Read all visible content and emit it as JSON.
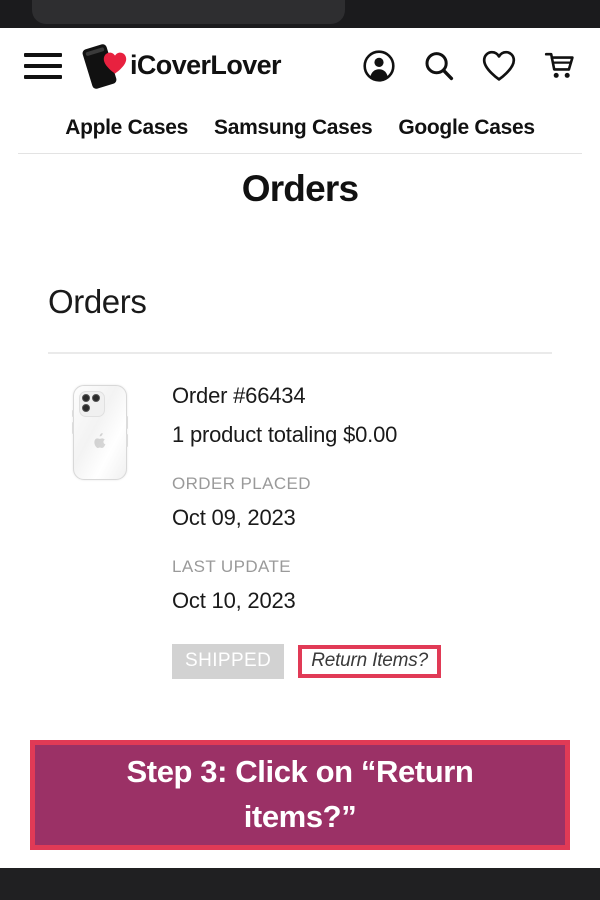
{
  "browser": {
    "top_bar": "",
    "bottom_bar": ""
  },
  "header": {
    "menu_icon": "hamburger-menu-icon",
    "logo_text": "iCoverLover",
    "logo_mark": "phone-with-heart-icon",
    "icons": [
      {
        "name": "account-icon",
        "label": "Account"
      },
      {
        "name": "search-icon",
        "label": "Search"
      },
      {
        "name": "wishlist-heart-icon",
        "label": "Wishlist"
      },
      {
        "name": "shopping-cart-icon",
        "label": "Cart"
      }
    ]
  },
  "nav": {
    "links": [
      {
        "label": "Apple Cases"
      },
      {
        "label": "Samsung Cases"
      },
      {
        "label": "Google Cases"
      }
    ]
  },
  "page": {
    "title": "Orders",
    "section_title": "Orders"
  },
  "order": {
    "thumbnail_alt": "clear-iphone-case-thumbnail",
    "number": "Order #66434",
    "summary": "1 product totaling $0.00",
    "order_placed_label": "ORDER PLACED",
    "order_placed_value": "Oct 09, 2023",
    "last_update_label": "LAST UPDATE",
    "last_update_value": "Oct 10, 2023",
    "status_badge": "SHIPPED",
    "return_link": "Return Items?"
  },
  "callout": {
    "text": "Step 3: Click on “Return items?”",
    "fill_color": "#9b3166",
    "border_color": "#e13a56"
  },
  "colors": {
    "accent_red": "#e13a56",
    "logo_heart": "#e8213f",
    "badge_gray": "#d2d2d2",
    "chrome_dark": "#1b1b1d"
  }
}
